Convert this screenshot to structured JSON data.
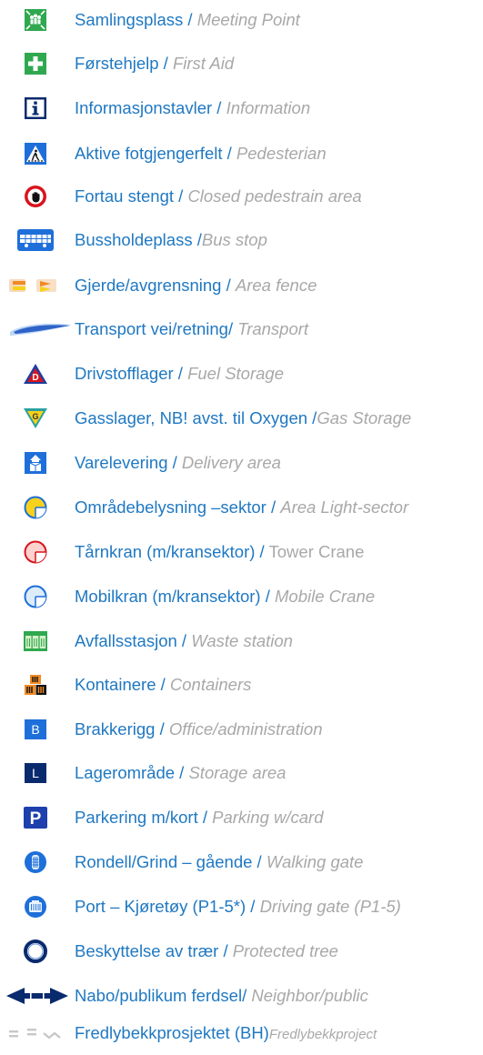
{
  "legend": {
    "items": [
      {
        "icon": "meeting-point-icon",
        "no": "Samlingsplass",
        "sep": " / ",
        "en": "Meeting Point"
      },
      {
        "icon": "first-aid-icon",
        "no": "Førstehjelp",
        "sep": " / ",
        "en": "First Aid"
      },
      {
        "icon": "information-icon",
        "no": "Informasjonstavler",
        "sep": " / ",
        "en": "Information"
      },
      {
        "icon": "pedestrian-crossing-icon",
        "no": "Aktive fotgjengerfelt",
        "sep": " / ",
        "en": "Pedesterian"
      },
      {
        "icon": "closed-pedestrian-icon",
        "no": "Fortau stengt",
        "sep": " / ",
        "en": "Closed pedestrain area"
      },
      {
        "icon": "bus-stop-icon",
        "no": "Bussholdeplass",
        "sep": " /",
        "en": "Bus stop"
      },
      {
        "icon": "area-fence-icon",
        "no": "Gjerde/avgrensning",
        "sep": " / ",
        "en": "Area fence"
      },
      {
        "icon": "transport-route-icon",
        "no": "Transport vei/retning/",
        "sep": " ",
        "en": "Transport"
      },
      {
        "icon": "fuel-storage-icon",
        "no": "Drivstofflager",
        "sep": " / ",
        "en": "Fuel Storage"
      },
      {
        "icon": "gas-storage-icon",
        "no": "Gasslager, NB! avst. til Oxygen",
        "sep": " /",
        "en": "Gas Storage"
      },
      {
        "icon": "delivery-area-icon",
        "no": "Varelevering",
        "sep": " / ",
        "en": "Delivery area"
      },
      {
        "icon": "area-light-sector-icon",
        "no": "Områdebelysning –sektor",
        "sep": " / ",
        "en": "Area Light-sector"
      },
      {
        "icon": "tower-crane-icon",
        "no": "Tårnkran (m/kransektor)",
        "sep": " / ",
        "en": "Tower Crane"
      },
      {
        "icon": "mobile-crane-icon",
        "no": "Mobilkran (m/kransektor)",
        "sep": " / ",
        "en": "Mobile Crane"
      },
      {
        "icon": "waste-station-icon",
        "no": "Avfallsstasjon",
        "sep": " / ",
        "en": "Waste station"
      },
      {
        "icon": "containers-icon",
        "no": "Kontainere",
        "sep": " / ",
        "en": "Containers"
      },
      {
        "icon": "office-b-icon",
        "no": "Brakkerigg",
        "sep": " / ",
        "en": "Office/administration",
        "badge": "B"
      },
      {
        "icon": "storage-l-icon",
        "no": "Lagerområde",
        "sep": " / ",
        "en": "Storage area",
        "badge": "L"
      },
      {
        "icon": "parking-icon",
        "no": "Parkering m/kort",
        "sep": " / ",
        "en": "Parking w/card",
        "badge": "P"
      },
      {
        "icon": "walking-gate-icon",
        "no": "Rondell/Grind – gående",
        "sep": " / ",
        "en": "Walking gate"
      },
      {
        "icon": "driving-gate-icon",
        "no": "Port – Kjøretøy (P1-5*)",
        "sep": " / ",
        "en": "Driving gate (P1-5)"
      },
      {
        "icon": "protected-tree-icon",
        "no": "Beskyttelse av trær",
        "sep": " / ",
        "en": "Protected tree"
      },
      {
        "icon": "two-way-arrow-icon",
        "no": "Nabo/publikum ferdsel/",
        "sep": " ",
        "en": "Neighbor/public"
      },
      {
        "icon": "project-boundary-icon",
        "no": "Fredlybekkprosjektet (BH)",
        "sep": "",
        "en": "Fredlybekkproject"
      }
    ]
  },
  "colors": {
    "norwegian_text": "#1f78c2",
    "english_text": "#a8a8a8",
    "blue": "#1e6fd9",
    "dark_blue": "#0a2a6e",
    "green": "#2fa84f",
    "red": "#d9141e",
    "orange": "#f08a24",
    "yellow": "#f7d11c",
    "salmon": "#e8746a",
    "brown": "#8b5a2b",
    "teal": "#2f8f8a",
    "grey": "#c8c8c8"
  }
}
